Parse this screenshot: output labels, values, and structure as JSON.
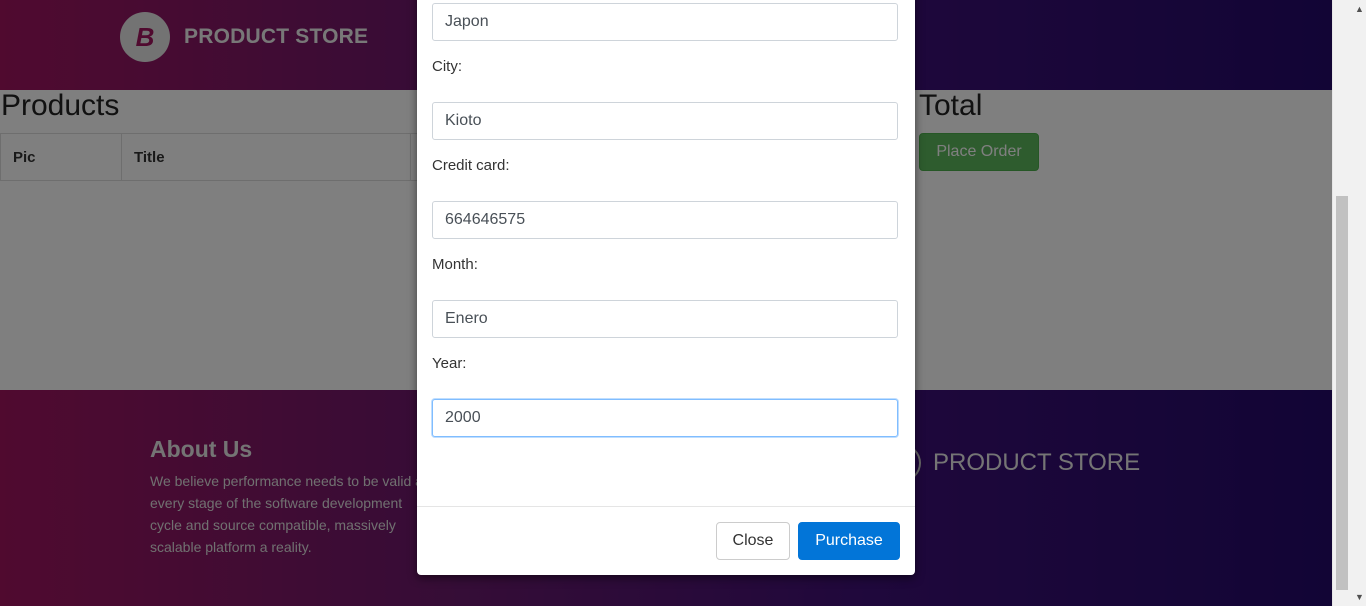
{
  "header": {
    "logo_letter": "B",
    "brand": "PRODUCT STORE"
  },
  "cart": {
    "products_title": "Products",
    "columns": [
      "Pic",
      "Title",
      ""
    ],
    "total_title": "Total",
    "place_order": "Place Order"
  },
  "footer": {
    "about_title": "About Us",
    "about_text": "We believe performance needs to be valid at every stage of the software development cycle and source compatible, massively scalable platform a reality.",
    "brand": "PRODUCT STORE"
  },
  "modal": {
    "fields": [
      {
        "label": "",
        "value": "Japon"
      },
      {
        "label": "City:",
        "value": "Kioto"
      },
      {
        "label": "Credit card:",
        "value": "664646575"
      },
      {
        "label": "Month:",
        "value": "Enero"
      },
      {
        "label": "Year:",
        "value": "2000"
      }
    ],
    "close_label": "Close",
    "purchase_label": "Purchase",
    "accent_color": "#0275d8"
  },
  "scrollbar": {
    "up_icon": "▲",
    "down_icon": "▼"
  }
}
